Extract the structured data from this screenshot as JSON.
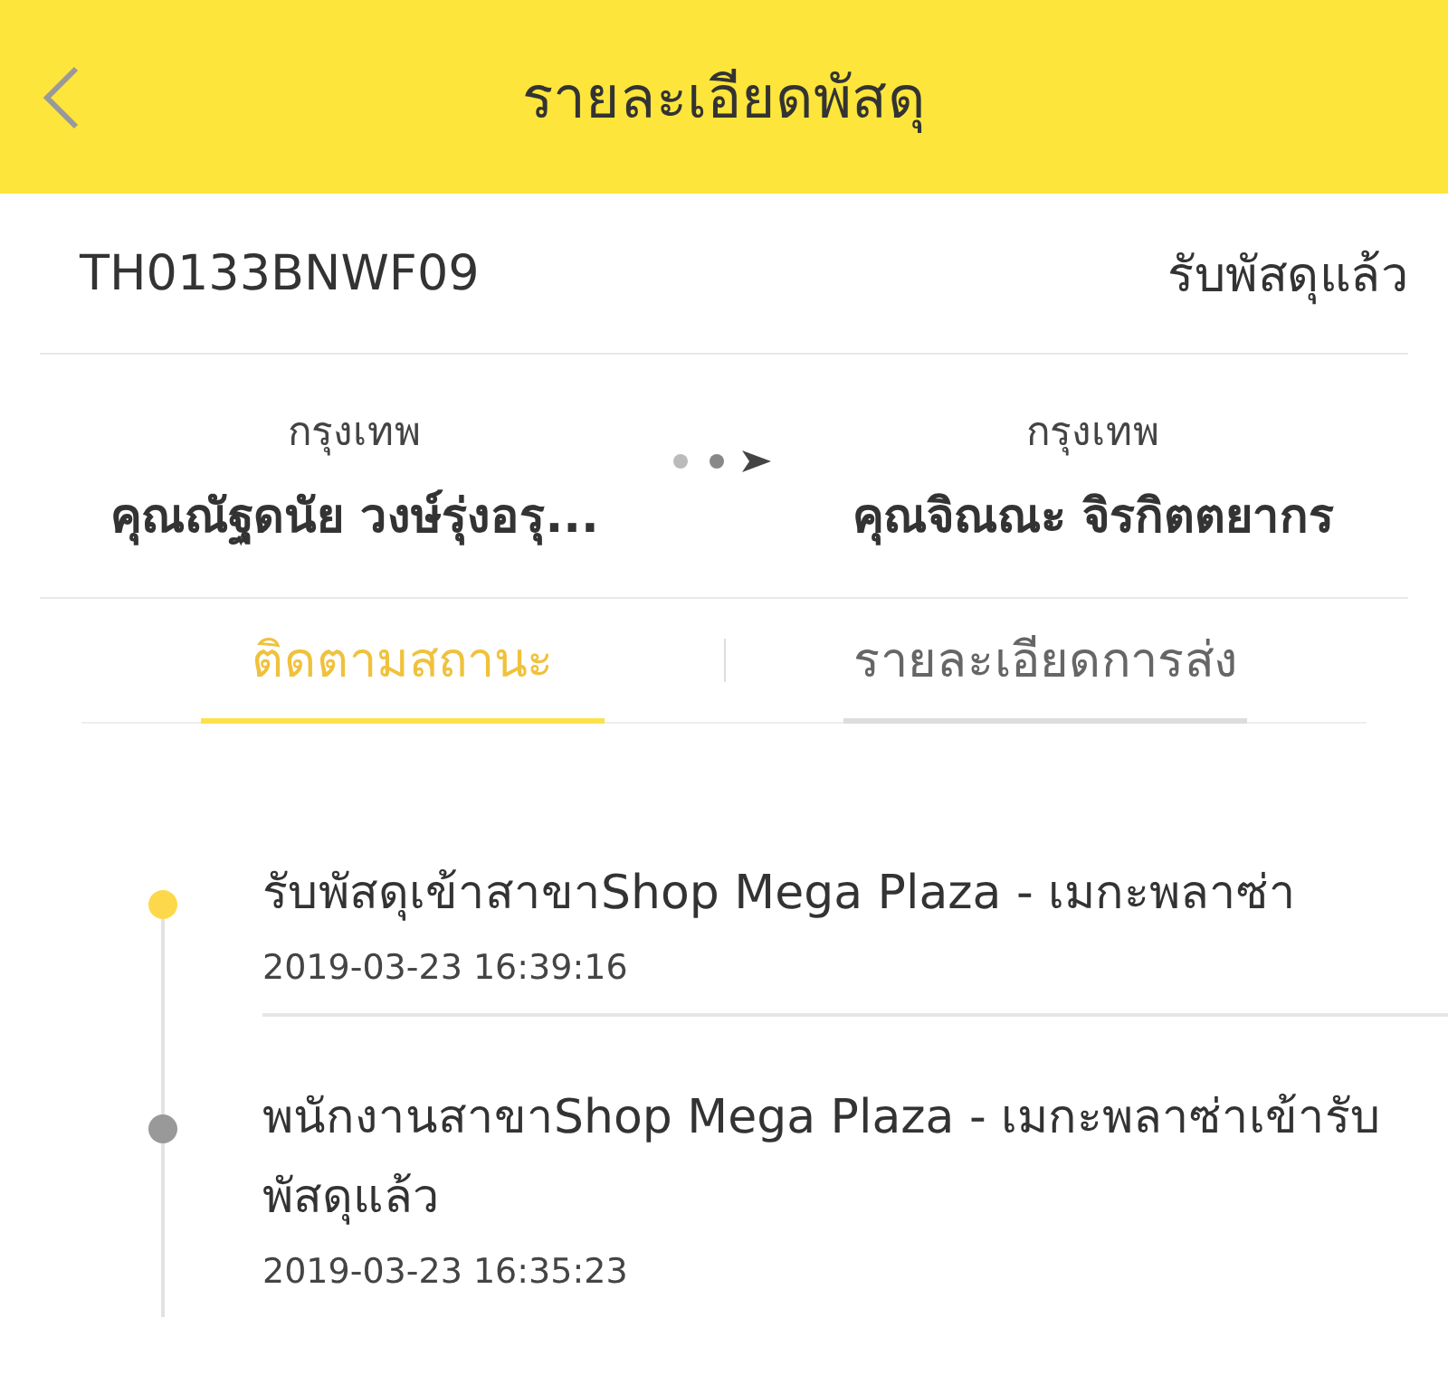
{
  "header": {
    "title": "รายละเอียดพัสดุ"
  },
  "parcel": {
    "tracking_number": "TH0133BNWF09",
    "status": "รับพัสดุแล้ว"
  },
  "route": {
    "sender": {
      "city": "กรุงเทพ",
      "name": "คุณณัฐดนัย  วงษ์รุ่งอรุ..."
    },
    "receiver": {
      "city": "กรุงเทพ",
      "name": "คุณจิณณะ จิรกิตตยากร"
    }
  },
  "tabs": [
    {
      "label": "ติดตามสถานะ",
      "selected": true
    },
    {
      "label": "รายละเอียดการส่ง",
      "selected": false
    }
  ],
  "events": [
    {
      "text": "รับพัสดุเข้าสาขาShop Mega Plaza - เมกะพลาซ่า",
      "time": "2019-03-23 16:39:16",
      "current": true
    },
    {
      "text": "พนักงานสาขาShop Mega Plaza - เมกะพลาซ่าเข้ารับพัสดุแล้ว",
      "time": "2019-03-23 16:35:23",
      "current": false
    }
  ]
}
